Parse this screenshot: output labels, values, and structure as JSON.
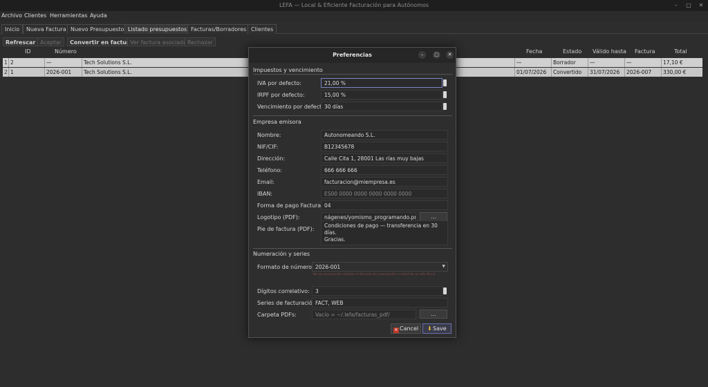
{
  "window": {
    "title": "LEFA — Local & Eficiente Facturación para Autónomos",
    "minimize_glyph": "–",
    "maximize_glyph": "□",
    "close_glyph": "✕"
  },
  "menu": [
    "Archivo",
    "Clientes",
    "Herramientas",
    "Ayuda"
  ],
  "tabs": [
    "Inicio",
    "Nueva Factura",
    "Nuevo Presupuesto",
    "Listado presupuestos",
    "Facturas/Borradores",
    "Clientes"
  ],
  "active_tab": "Listado presupuestos",
  "toolbar": {
    "refresh": "Refrescar",
    "accept": "Aceptar",
    "convert": "Convertir en factura",
    "view_invoice": "Ver factura asociada",
    "reject": "Rechazar"
  },
  "table": {
    "columns": {
      "id": "ID",
      "numero": "Número",
      "fecha": "Fecha",
      "estado": "Estado",
      "valido_hasta": "Válido hasta",
      "factura": "Factura",
      "total": "Total"
    },
    "rows": [
      {
        "row_num": "1",
        "id": "2",
        "numero": "—",
        "cliente": "Tech Solutions S.L.",
        "fecha": "—",
        "estado": "Borrador",
        "valido_hasta": "—",
        "factura": "—",
        "total": "17,10 €"
      },
      {
        "row_num": "2",
        "id": "1",
        "numero": "2026-001",
        "cliente": "Tech Solutions S.L.",
        "fecha": "01/07/2026",
        "estado": "Convertido",
        "valido_hasta": "31/07/2026",
        "factura": "2026-007",
        "total": "330,00 €"
      }
    ]
  },
  "dialog": {
    "title": "Preferencias",
    "minimize_glyph": "–",
    "maximize_glyph": "□",
    "close_glyph": "✕",
    "sections": {
      "taxes": "Impuestos y vencimiento",
      "company": "Empresa emisora",
      "numbering": "Numeración y series"
    },
    "taxes": {
      "iva_label": "IVA por defecto:",
      "iva_value": "21,00 %",
      "irpf_label": "IRPF por defecto:",
      "irpf_value": "15,00 %",
      "due_label": "Vencimiento por defecto:",
      "due_value": "30 días"
    },
    "company": {
      "name_label": "Nombre:",
      "name_value": "Autonomeando S.L.",
      "nif_label": "NIF/CIF:",
      "nif_value": "B12345678",
      "address_label": "Dirección:",
      "address_value": "Calle Cita 1, 28001 Las rías muy bajas",
      "phone_label": "Teléfono:",
      "phone_value": "666 666 666",
      "email_label": "Email:",
      "email_value": "facturacion@miempresa.es",
      "iban_label": "IBANː",
      "iban_placeholder": "ES00 0000 0000 0000 0000 0000",
      "payment_label": "Forma de pago Facturae:",
      "payment_value": "04",
      "logo_label": "Logotipo (PDF):",
      "logo_value": "nágenes/yomismo_programando.png",
      "logo_browse": "...",
      "footer_label": "Pie de factura (PDF):",
      "footer_value": "Condiciones de pago — transferencia en 30 días.\nGracias."
    },
    "numbering": {
      "format_label": "Formato de número:",
      "format_value": "2026-001",
      "warning": "No se recomienda cambiar el formato de numeración a mitad de un año fiscal.",
      "digits_label": "Dígitos correlativo:",
      "digits_value": "3",
      "series_label": "Series de facturación:",
      "series_value": "FACT, WEB",
      "pdf_label": "Carpeta PDFs:",
      "pdf_placeholder": "Vacío = ~/.lefa/facturas_pdf/",
      "pdf_browse": "..."
    },
    "buttons": {
      "cancel": "Cancel",
      "save": "Save"
    }
  },
  "colors": {
    "background": "#2d2d2d",
    "row": "#d0d0d0",
    "focus": "#7a86c8",
    "warning": "#8a4a4a",
    "cancel_icon": "#c0392b",
    "save_icon": "#e8c23a"
  },
  "icons": [
    "cancel-icon",
    "save-icon",
    "spin-arrows-icon",
    "dropdown-arrow-icon"
  ]
}
